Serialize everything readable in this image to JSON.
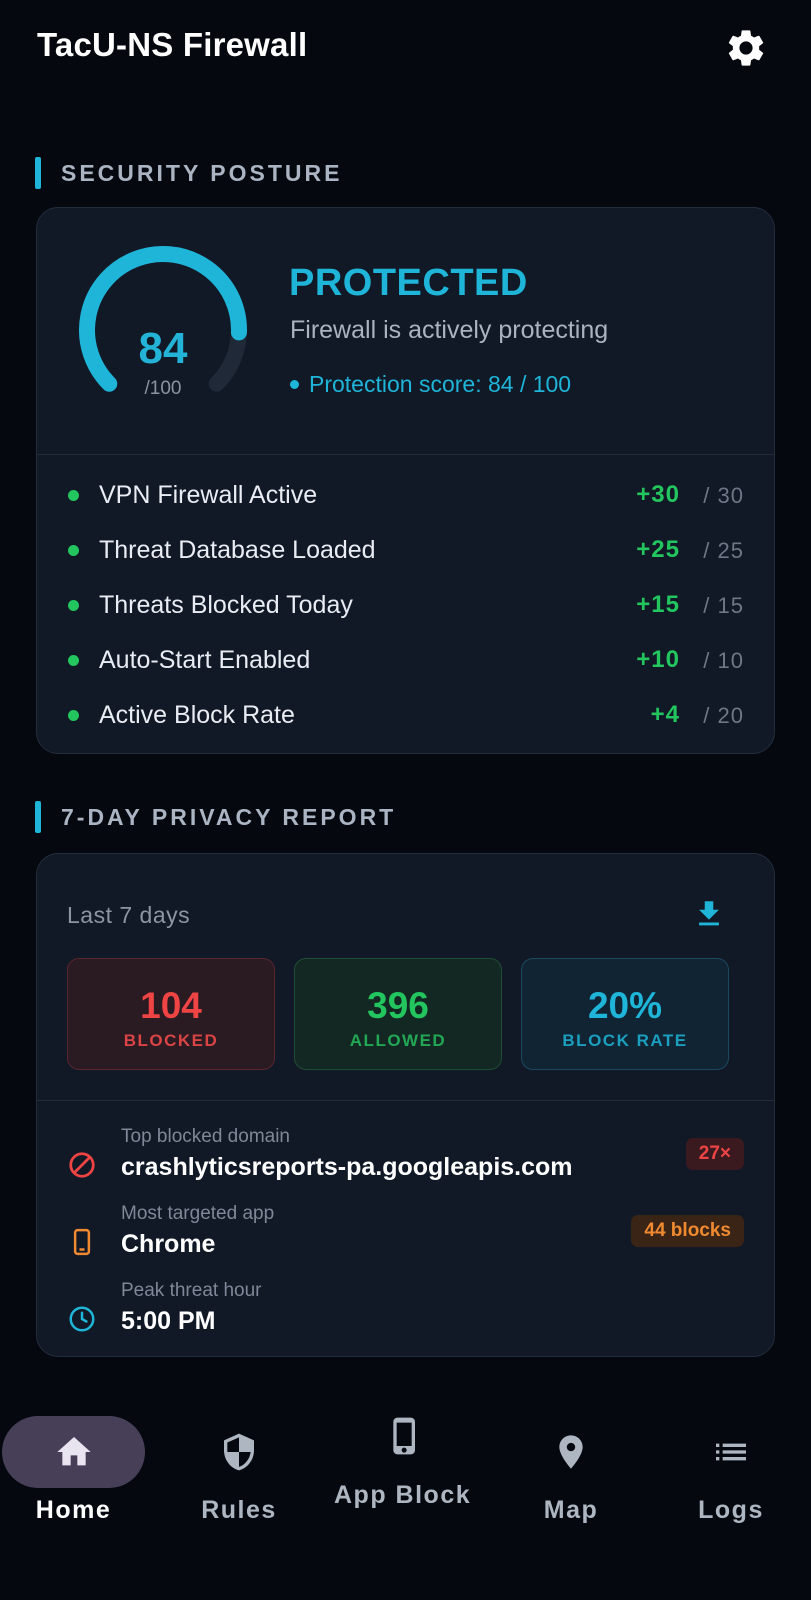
{
  "app": {
    "title": "TacU-NS Firewall",
    "settings_icon": "gear-icon"
  },
  "security_posture": {
    "section_title": "SECURITY POSTURE",
    "score": "84",
    "score_max": "/100",
    "score_fraction": 0.84,
    "status": "PROTECTED",
    "status_message": "Firewall is actively protecting",
    "protection_score_text": "Protection score: 84 / 100",
    "factors": [
      {
        "label": "VPN Firewall Active",
        "points": "+30",
        "max": "/ 30"
      },
      {
        "label": "Threat Database Loaded",
        "points": "+25",
        "max": "/ 25"
      },
      {
        "label": "Threats Blocked Today",
        "points": "+15",
        "max": "/ 15"
      },
      {
        "label": "Auto-Start Enabled",
        "points": "+10",
        "max": "/ 10"
      },
      {
        "label": "Active Block Rate",
        "points": "+4",
        "max": "/ 20"
      }
    ]
  },
  "privacy_report": {
    "section_title": "7-DAY PRIVACY REPORT",
    "range_label": "Last 7 days",
    "download_icon": "download-icon",
    "stats": {
      "blocked": {
        "value": "104",
        "label": "BLOCKED"
      },
      "allowed": {
        "value": "396",
        "label": "ALLOWED"
      },
      "block_rate": {
        "value": "20%",
        "label": "BLOCK RATE"
      }
    },
    "top_blocked_domain": {
      "label": "Top blocked domain",
      "value": "crashlyticsreports-pa.googleapis.com",
      "badge": "27×",
      "icon": "block-icon"
    },
    "most_targeted_app": {
      "label": "Most targeted app",
      "value": "Chrome",
      "badge": "44 blocks",
      "icon": "phone-icon"
    },
    "peak_threat_hour": {
      "label": "Peak threat hour",
      "value": "5:00 PM",
      "icon": "clock-icon"
    }
  },
  "colors": {
    "accent": "#1fb5d8",
    "success": "#22c55e",
    "danger": "#ef4444",
    "warning": "#f08a30",
    "background": "#05080e",
    "card": "#111826"
  },
  "bottom_nav": {
    "active": "Home",
    "items": [
      {
        "label": "Home",
        "icon": "home-icon"
      },
      {
        "label": "Rules",
        "icon": "shield-icon"
      },
      {
        "label": "App Block",
        "icon": "smartphone-icon"
      },
      {
        "label": "Map",
        "icon": "map-pin-icon"
      },
      {
        "label": "Logs",
        "icon": "list-icon"
      }
    ]
  }
}
